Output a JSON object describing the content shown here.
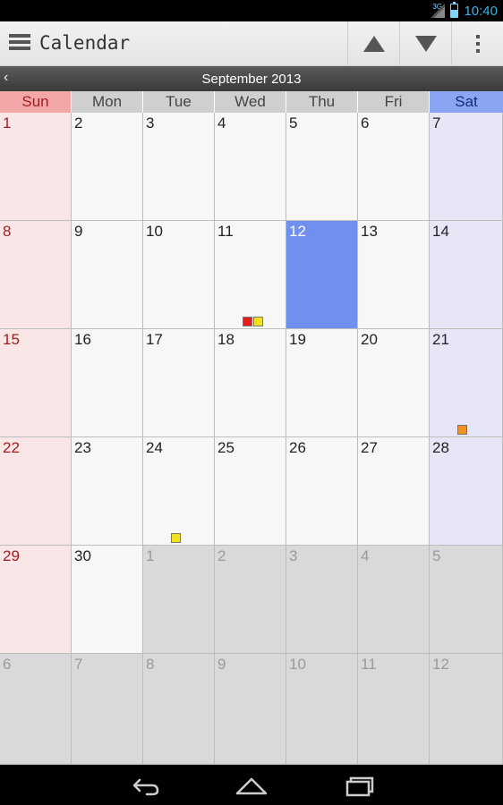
{
  "status_bar": {
    "network": "3G",
    "time": "10:40"
  },
  "action_bar": {
    "title": "Calendar"
  },
  "month_header": {
    "title": "September 2013",
    "prev_symbol": "‹"
  },
  "weekdays": [
    "Sun",
    "Mon",
    "Tue",
    "Wed",
    "Thu",
    "Fri",
    "Sat"
  ],
  "calendar": {
    "weeks": [
      [
        {
          "d": "1",
          "t": "sun"
        },
        {
          "d": "2",
          "t": "cur"
        },
        {
          "d": "3",
          "t": "cur"
        },
        {
          "d": "4",
          "t": "cur"
        },
        {
          "d": "5",
          "t": "cur"
        },
        {
          "d": "6",
          "t": "cur"
        },
        {
          "d": "7",
          "t": "sat"
        }
      ],
      [
        {
          "d": "8",
          "t": "sun"
        },
        {
          "d": "9",
          "t": "cur"
        },
        {
          "d": "10",
          "t": "cur"
        },
        {
          "d": "11",
          "t": "cur",
          "markers": [
            "#e02020",
            "#f0e020"
          ]
        },
        {
          "d": "12",
          "t": "today"
        },
        {
          "d": "13",
          "t": "cur"
        },
        {
          "d": "14",
          "t": "sat"
        }
      ],
      [
        {
          "d": "15",
          "t": "sun"
        },
        {
          "d": "16",
          "t": "cur"
        },
        {
          "d": "17",
          "t": "cur"
        },
        {
          "d": "18",
          "t": "cur"
        },
        {
          "d": "19",
          "t": "cur"
        },
        {
          "d": "20",
          "t": "cur"
        },
        {
          "d": "21",
          "t": "sat",
          "markers": [
            "#f09020"
          ]
        }
      ],
      [
        {
          "d": "22",
          "t": "sun"
        },
        {
          "d": "23",
          "t": "cur"
        },
        {
          "d": "24",
          "t": "cur",
          "markers": [
            "#f0e020"
          ]
        },
        {
          "d": "25",
          "t": "cur"
        },
        {
          "d": "26",
          "t": "cur"
        },
        {
          "d": "27",
          "t": "cur"
        },
        {
          "d": "28",
          "t": "sat"
        }
      ],
      [
        {
          "d": "29",
          "t": "sun"
        },
        {
          "d": "30",
          "t": "cur"
        },
        {
          "d": "1",
          "t": "other"
        },
        {
          "d": "2",
          "t": "other"
        },
        {
          "d": "3",
          "t": "other"
        },
        {
          "d": "4",
          "t": "other"
        },
        {
          "d": "5",
          "t": "other"
        }
      ],
      [
        {
          "d": "6",
          "t": "other"
        },
        {
          "d": "7",
          "t": "other"
        },
        {
          "d": "8",
          "t": "other"
        },
        {
          "d": "9",
          "t": "other"
        },
        {
          "d": "10",
          "t": "other"
        },
        {
          "d": "11",
          "t": "other"
        },
        {
          "d": "12",
          "t": "other"
        }
      ]
    ]
  },
  "colors": {
    "sunday_header": "#f4a7a7",
    "saturday_header": "#8aa6f2",
    "today": "#7090f0",
    "clock": "#33b5e5"
  },
  "icons": {
    "menu": "hamburger-menu-icon",
    "up": "arrow-up-icon",
    "down": "arrow-down-icon",
    "more": "overflow-menu-icon",
    "back": "back-icon",
    "home": "home-icon",
    "recent": "recent-apps-icon"
  }
}
